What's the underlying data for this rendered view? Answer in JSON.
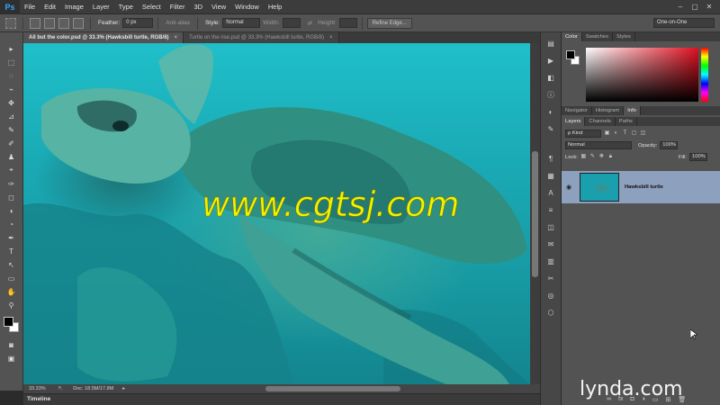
{
  "app": {
    "logo": "Ps"
  },
  "menu": [
    "File",
    "Edit",
    "Image",
    "Layer",
    "Type",
    "Select",
    "Filter",
    "3D",
    "View",
    "Window",
    "Help"
  ],
  "window_buttons": [
    "–",
    "▢",
    "✕"
  ],
  "options": {
    "feather_label": "Feather:",
    "feather_value": "0 px",
    "antialias_label": "Anti-alias",
    "style_label": "Style:",
    "style_value": "Normal",
    "width_label": "Width:",
    "height_label": "Height:",
    "refine_label": "Refine Edge...",
    "workspace": "One-on-One"
  },
  "tabs": [
    {
      "label": "All but the color.psd @ 33.3% (Hawksbill turtle, RGB/8)",
      "close": "×"
    },
    {
      "label": "Turtle on the rise.psd @ 33.3% (Hawksbill turtle, RGB/8)",
      "close": "×"
    }
  ],
  "tools": [
    "▸",
    "⬚",
    "◌",
    "⌁",
    "✥",
    "⊿",
    "✎",
    "✐",
    "♟",
    "⌖",
    "✑",
    "◻",
    "◖",
    "◔",
    "✒",
    "T",
    "↖",
    "▭",
    "✋",
    "⚲"
  ],
  "status": {
    "zoom": "33.33%",
    "doc": "Doc: 18.5M/17.8M"
  },
  "timeline": {
    "label": "Timeline"
  },
  "color_panel": {
    "tabs": [
      "Color",
      "Swatches",
      "Styles"
    ]
  },
  "nav_panel": {
    "tabs": [
      "Navigator",
      "Histogram",
      "Info"
    ]
  },
  "layers_panel": {
    "tabs": [
      "Layers",
      "Channels",
      "Paths"
    ],
    "kind": "ρ Kind",
    "blend": "Normal",
    "opacity_label": "Opacity:",
    "opacity": "100%",
    "lock_label": "Lock:",
    "fill_label": "Fill:",
    "fill": "100%",
    "layer_name": "Hawksbill turtle"
  },
  "watermark": {
    "text": "www.cgtsj.com",
    "color": "#f2f200"
  },
  "brand": {
    "text": "lynda.com"
  },
  "colors": {
    "accent": "#31a8ff",
    "selected_layer": "#8da0bd"
  }
}
